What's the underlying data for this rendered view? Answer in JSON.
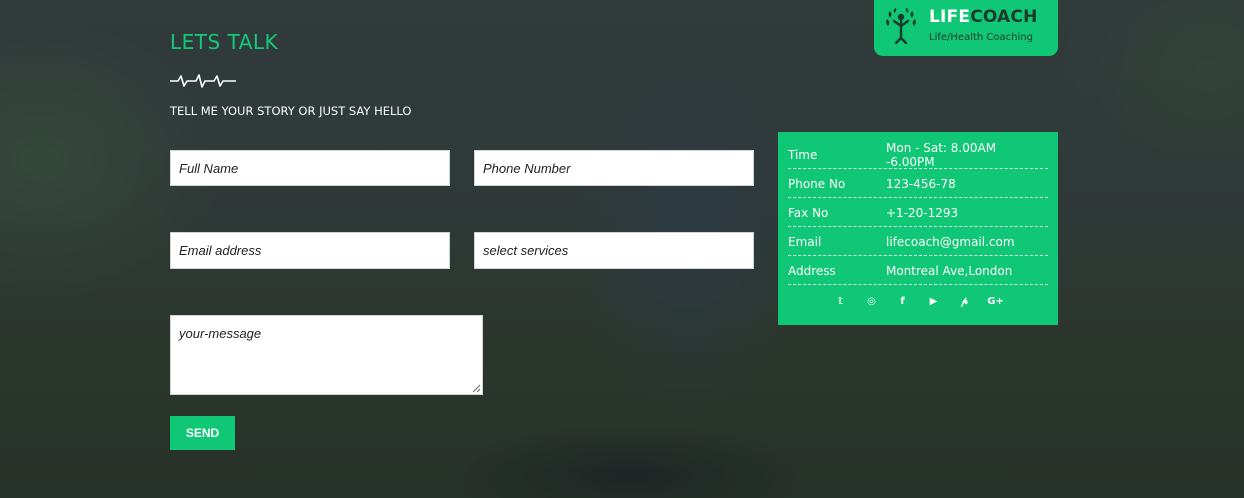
{
  "brand": {
    "name_part1": "LIFE",
    "name_part2": "COACH",
    "tagline": "Life/Health Coaching",
    "accent_color": "#0fc774",
    "icon": "tree-person-icon"
  },
  "contact": {
    "title": "LETS TALK",
    "subtitle": "TELL ME YOUR STORY OR JUST SAY HELLO",
    "divider_icon": "heartbeat-icon",
    "form": {
      "full_name_placeholder": "Full Name",
      "phone_placeholder": "Phone Number",
      "email_placeholder": "Email address",
      "services_selected": "select services",
      "message_placeholder": "your-message",
      "send_label": "SEND"
    }
  },
  "info": {
    "rows": [
      {
        "label": "Time",
        "value": "Mon - Sat: 8.00AM -6.00PM"
      },
      {
        "label": "Phone No",
        "value": "123-456-78"
      },
      {
        "label": "Fax No",
        "value": "+1-20-1293"
      },
      {
        "label": "Email",
        "value": "lifecoach@gmail.com"
      },
      {
        "label": "Address",
        "value": "Montreal Ave,London"
      }
    ],
    "social": [
      {
        "name": "twitter-icon",
        "glyph": "𝕥"
      },
      {
        "name": "instagram-icon",
        "glyph": "◎"
      },
      {
        "name": "facebook-icon",
        "glyph": "f"
      },
      {
        "name": "youtube-icon",
        "glyph": "▶"
      },
      {
        "name": "pinterest-icon",
        "glyph": "𝓅"
      },
      {
        "name": "google-plus-icon",
        "glyph": "G+"
      }
    ]
  }
}
